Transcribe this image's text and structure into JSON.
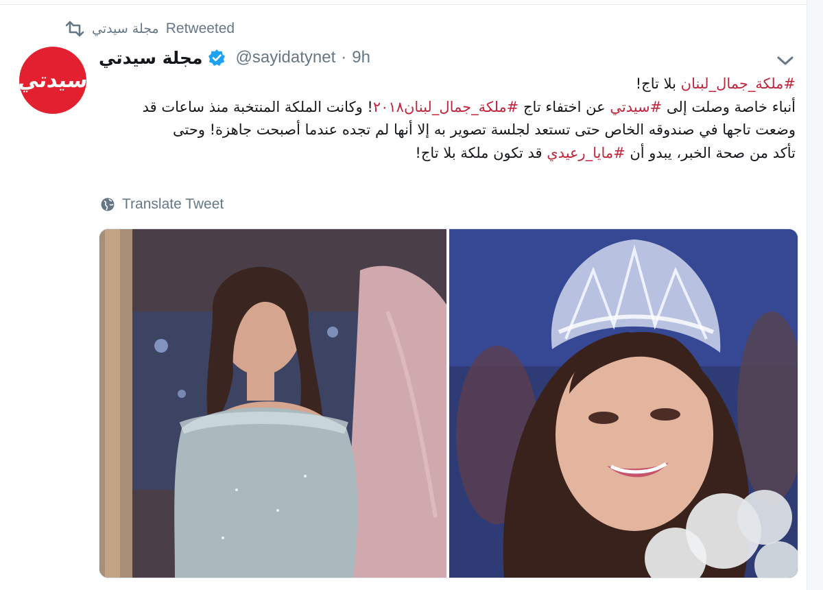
{
  "retweet": {
    "icon": "retweet-icon",
    "retweeter": "مجلة سيدتي",
    "label": "Retweeted"
  },
  "author": {
    "avatar_text": "سيدتي",
    "avatar_color": "#e3202f",
    "display_name": "مجلة سيدتي",
    "handle": "@sayidatynet",
    "separator": "·",
    "time": "9h",
    "verified": true,
    "verified_icon": "verified-badge-icon"
  },
  "tweet": {
    "line1": {
      "hashtag": "#ملكة_جمال_لبنان",
      "text": " بلا تاج!"
    },
    "line2": {
      "t1": "أنباء خاصة وصلت إلى ",
      "h1": "#سيدتي",
      "t2": " عن اختفاء تاج ",
      "h2": "#ملكة_جمال_لبنان٢٠١٨",
      "t3": "! وكانت الملكة المنتخبة منذ ساعات قد"
    },
    "line3": "وضعت تاجها في صندوقه الخاص حتى تستعد لجلسة تصوير به إلا أنها لم تجده عندما أصبحت جاهزة! وحتى",
    "line4": {
      "t1": "تأكد من صحة الخبر، يبدو  أن ",
      "h1": "#مايا_رعيدي",
      "t2": " قد تكون ملكة بلا تاج!"
    },
    "hashtag_color": "#c0253b"
  },
  "translate": {
    "icon": "globe-icon",
    "label": "Translate Tweet"
  },
  "actions": {
    "caret_icon": "chevron-down-icon"
  }
}
